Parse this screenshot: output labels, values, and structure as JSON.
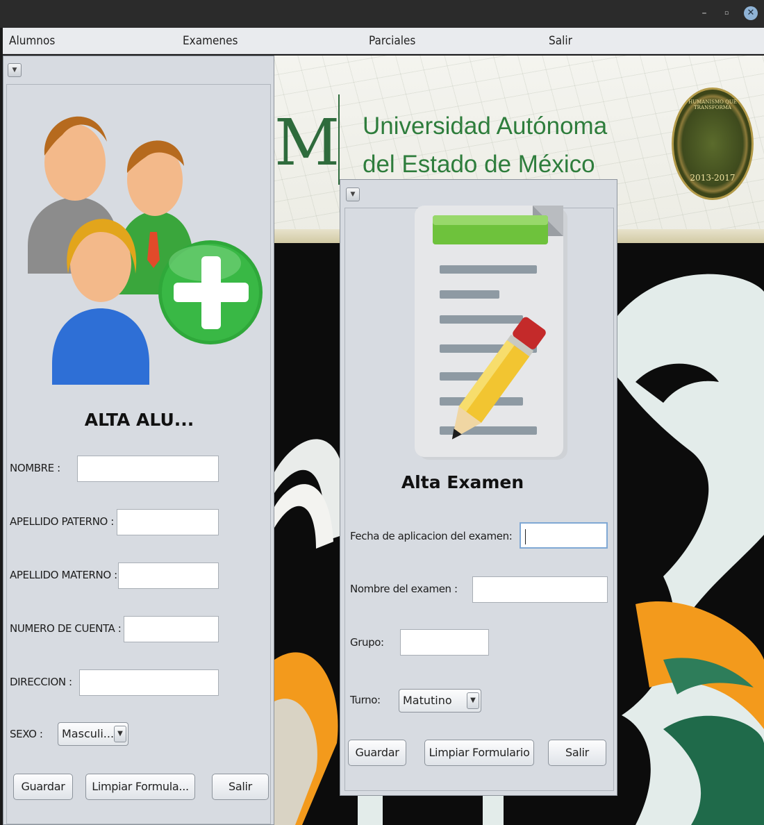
{
  "window": {
    "minimize": "–",
    "maximize": "▫",
    "close": "✕"
  },
  "menu": [
    "Alumnos",
    "Examenes",
    "Parciales",
    "Salir"
  ],
  "banner": {
    "letter": "M",
    "line1": "Universidad Autónoma",
    "line2": "del Estado de México",
    "seal_motto": "HUMANISMO QUE TRANSFORMA",
    "seal_years": "2013-2017"
  },
  "alumnos_form": {
    "collapse_icon": "▼",
    "title": "ALTA ALU...",
    "fields": [
      {
        "label": "NOMBRE :",
        "value": ""
      },
      {
        "label": "APELLIDO PATERNO :",
        "value": ""
      },
      {
        "label": "APELLIDO MATERNO :",
        "value": ""
      },
      {
        "label": "NUMERO DE CUENTA :",
        "value": ""
      },
      {
        "label": "DIRECCION :",
        "value": ""
      }
    ],
    "sexo_label": "SEXO :",
    "sexo_value": "Masculi...",
    "buttons": {
      "save": "Guardar",
      "clear": "Limpiar Formula...",
      "exit": "Salir"
    }
  },
  "examen_form": {
    "collapse_icon": "▼",
    "title": "Alta Examen",
    "fecha_label": "Fecha de aplicacion del examen:",
    "fecha_value": "",
    "nombre_label": "Nombre del examen :",
    "nombre_value": "",
    "grupo_label": "Grupo:",
    "grupo_value": "",
    "turno_label": "Turno:",
    "turno_value": "Matutino",
    "buttons": {
      "save": "Guardar",
      "clear": "Limpiar Formulario",
      "exit": "Salir"
    }
  },
  "colors": {
    "uaem_green": "#2e7d3c",
    "add_green": "#2fa83a",
    "frame_bg": "#d7dbe1",
    "focus_border": "#7fa8d4"
  }
}
